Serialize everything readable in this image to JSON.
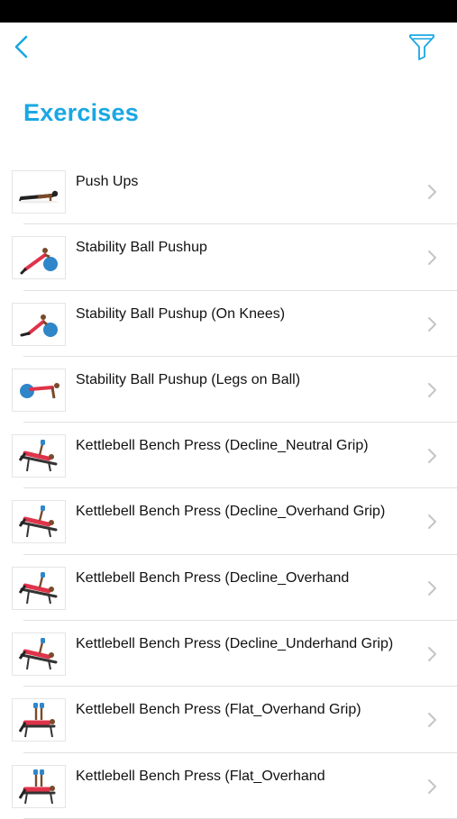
{
  "nav": {
    "back_icon": "chevron-left-icon",
    "filter_icon": "funnel-icon"
  },
  "page": {
    "title": "Exercises"
  },
  "colors": {
    "accent": "#1aa7e3",
    "separator": "#e1e1e1",
    "chevron": "#c4c4c4",
    "text": "#111111"
  },
  "exercises": [
    {
      "label": "Push Ups",
      "thumb": "push-up"
    },
    {
      "label": "Stability Ball Pushup",
      "thumb": "ball-pushup"
    },
    {
      "label": "Stability Ball Pushup (On Knees)",
      "thumb": "ball-pushup-knees"
    },
    {
      "label": "Stability Ball Pushup (Legs on Ball)",
      "thumb": "ball-pushup-legs"
    },
    {
      "label": "Kettlebell Bench Press (Decline_Neutral Grip)",
      "thumb": "decline-press"
    },
    {
      "label": "Kettlebell Bench Press (Decline_Overhand Grip)",
      "thumb": "decline-press"
    },
    {
      "label": "Kettlebell Bench Press (Decline_Overhand",
      "thumb": "decline-press"
    },
    {
      "label": "Kettlebell Bench Press (Decline_Underhand Grip)",
      "thumb": "decline-press"
    },
    {
      "label": "Kettlebell Bench Press (Flat_Overhand Grip)",
      "thumb": "flat-press"
    },
    {
      "label": "Kettlebell Bench Press (Flat_Overhand",
      "thumb": "flat-press"
    }
  ]
}
